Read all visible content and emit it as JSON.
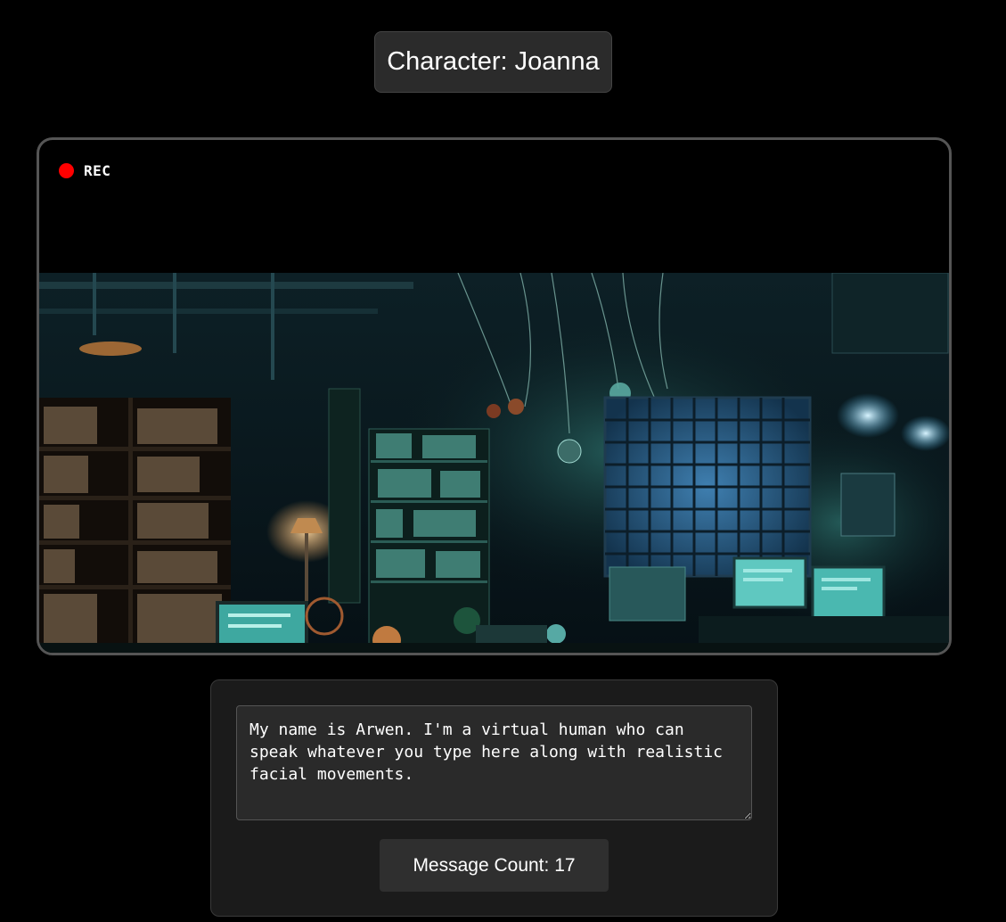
{
  "character": {
    "prefix": "Character: ",
    "name": "Joanna",
    "label": "Character: Joanna"
  },
  "video": {
    "rec_label": "REC",
    "rec_color": "#ff0000",
    "scene_icon": "cyber-library-background-image"
  },
  "chat": {
    "message_text": "My name is Arwen. I'm a virtual human who can speak whatever you type here along with realistic facial movements.",
    "count_label": "Message Count: 17",
    "count_value": 17
  },
  "colors": {
    "background": "#000000",
    "panel": "#1b1b1b",
    "frame_border": "#555555",
    "accent_teal": "#39c8c0"
  }
}
